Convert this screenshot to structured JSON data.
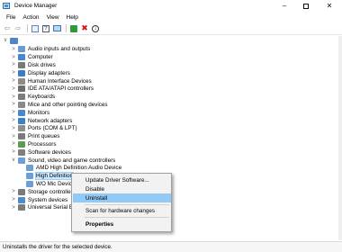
{
  "window": {
    "title": "Device Manager"
  },
  "menu": [
    "File",
    "Action",
    "View",
    "Help"
  ],
  "toolbar": [
    "back-arrow-icon",
    "forward-arrow-icon",
    "properties-icon",
    "help-icon",
    "computer-icon",
    "update-driver-icon",
    "uninstall-icon",
    "download-icon"
  ],
  "tree": {
    "rows": [
      {
        "label": "Audio inputs and outputs",
        "expander": ">",
        "color": "#6a9bd1"
      },
      {
        "label": "Computer",
        "expander": ">",
        "color": "#4b86c9"
      },
      {
        "label": "Disk drives",
        "expander": ">",
        "color": "#7a7a7a"
      },
      {
        "label": "Display adapters",
        "expander": ">",
        "color": "#3d7cc4"
      },
      {
        "label": "Human Interface Devices",
        "expander": ">",
        "color": "#8c8c8c"
      },
      {
        "label": "IDE ATA/ATAPI controllers",
        "expander": ">",
        "color": "#6e6e6e"
      },
      {
        "label": "Keyboards",
        "expander": ">",
        "color": "#7d7d7d"
      },
      {
        "label": "Mice and other pointing devices",
        "expander": ">",
        "color": "#8a8a8a"
      },
      {
        "label": "Monitors",
        "expander": ">",
        "color": "#4a88cc"
      },
      {
        "label": "Network adapters",
        "expander": ">",
        "color": "#3f7fc3"
      },
      {
        "label": "Ports (COM & LPT)",
        "expander": ">",
        "color": "#8e8e8e"
      },
      {
        "label": "Print queues",
        "expander": ">",
        "color": "#7b7b7b"
      },
      {
        "label": "Processors",
        "expander": ">",
        "color": "#5c9c52"
      },
      {
        "label": "Software devices",
        "expander": ">",
        "color": "#7f7f7f"
      },
      {
        "label": "Sound, video and game controllers",
        "expander": "v",
        "color": "#6b9fd6"
      },
      {
        "label": "AMD High Definition Audio Device",
        "expander": "",
        "color": "#6b9fd6"
      },
      {
        "label": "High Definition",
        "expander": "",
        "color": "#6b9fd6"
      },
      {
        "label": "WO Mic Devic",
        "expander": "",
        "color": "#6b9fd6"
      },
      {
        "label": "Storage controller",
        "expander": ">",
        "color": "#7a7a7a"
      },
      {
        "label": "System devices",
        "expander": ">",
        "color": "#4f8acb"
      },
      {
        "label": "Universal Serial Bus",
        "expander": ">",
        "color": "#7c7c7c"
      }
    ]
  },
  "context_menu": {
    "update": "Update Driver Software...",
    "disable": "Disable",
    "uninstall": "Uninstall",
    "scan": "Scan for hardware changes",
    "properties": "Properties"
  },
  "status": "Uninstalls the driver for the selected device."
}
